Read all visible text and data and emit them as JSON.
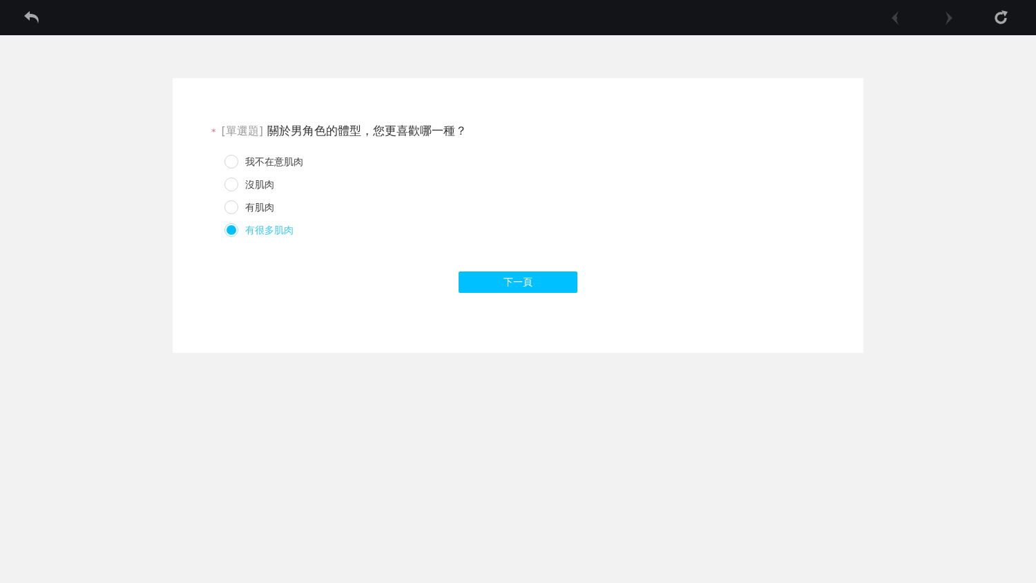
{
  "toolbar": {
    "previous_disabled": true,
    "next_disabled": true
  },
  "question": {
    "required_mark": "*",
    "type_label": "[單選題]",
    "title": "關於男角色的體型，您更喜歡哪一種？",
    "options": [
      {
        "label": "我不在意肌肉",
        "selected": false
      },
      {
        "label": "沒肌肉",
        "selected": false
      },
      {
        "label": "有肌肉",
        "selected": false
      },
      {
        "label": "有很多肌肉",
        "selected": true
      }
    ]
  },
  "next_button": "下一頁"
}
